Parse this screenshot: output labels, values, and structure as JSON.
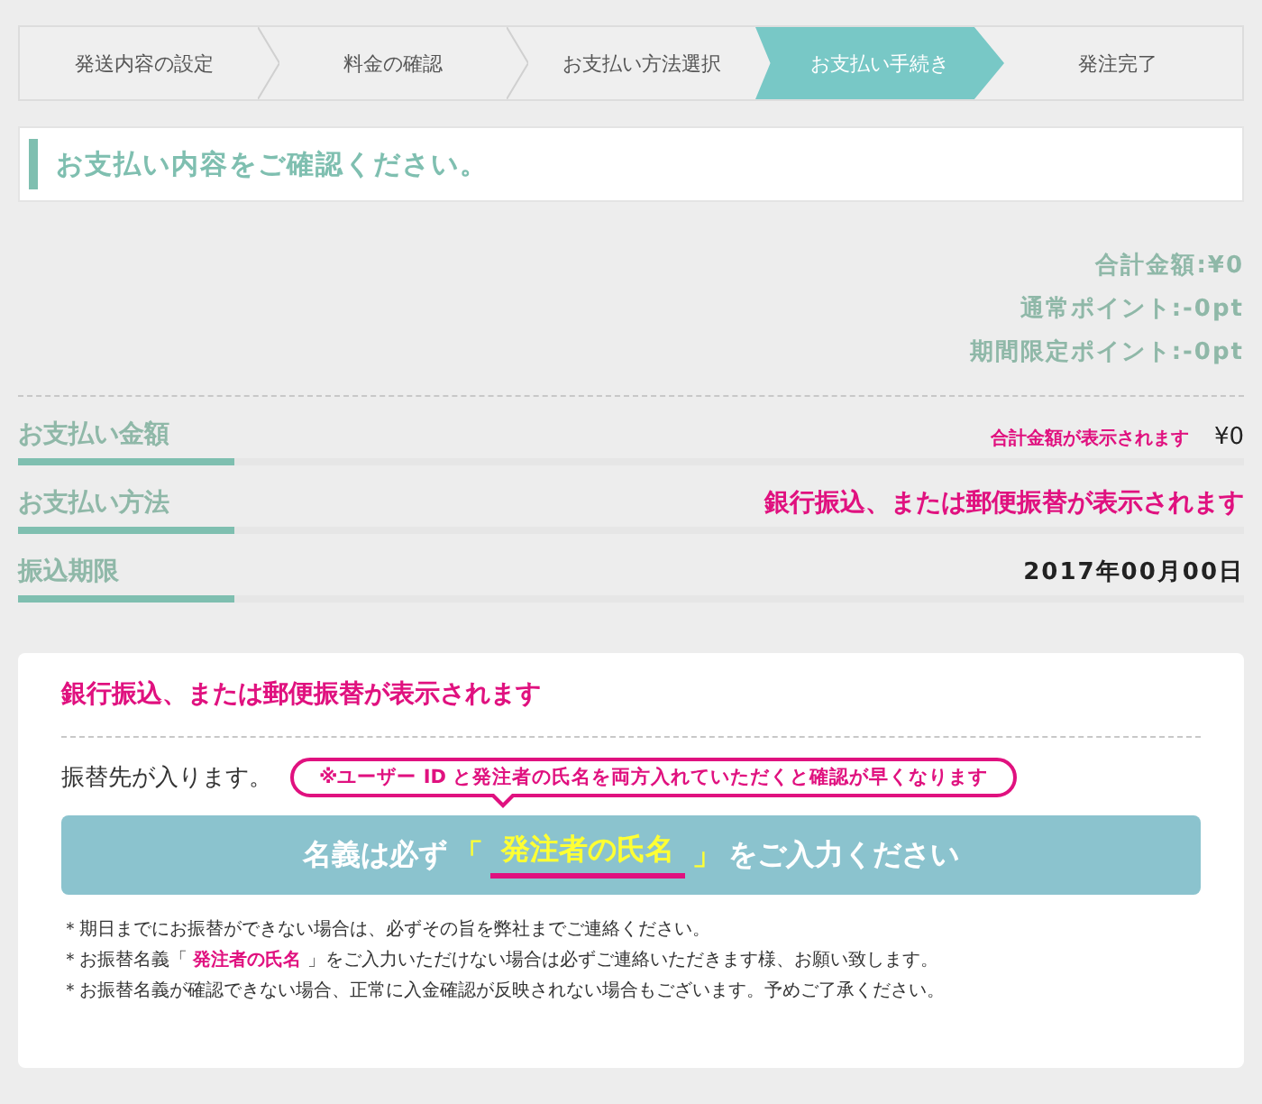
{
  "steps": [
    {
      "label": "発送内容の設定",
      "selected": false
    },
    {
      "label": "料金の確認",
      "selected": false
    },
    {
      "label": "お支払い方法選択",
      "selected": false
    },
    {
      "label": "お支払い手続き",
      "selected": true
    },
    {
      "label": "発注完了",
      "selected": false
    }
  ],
  "heading": "お支払い内容をご確認ください。",
  "totals": [
    "合計金額:¥0",
    "通常ポイント:-0pt",
    "期間限定ポイント:-0pt"
  ],
  "rows": [
    {
      "label": "お支払い金額",
      "kind": "amount",
      "note": "合計金額が表示されます",
      "value": "¥0"
    },
    {
      "label": "お支払い方法",
      "kind": "method",
      "value": "銀行振込、または郵便振替が表示されます"
    },
    {
      "label": "振込期限",
      "kind": "date",
      "value": "2017年00月00日"
    }
  ],
  "card": {
    "title": "銀行振込、または郵便振替が表示されます",
    "destination": "振替先が入ります。",
    "callout": "※ユーザー ID と発注者の氏名を両方入れていただくと確認が早くなります",
    "banner": {
      "before": "名義は必ず",
      "open": "「",
      "highlight": "発注者の氏名",
      "close": "」",
      "after": "をご入力ください"
    },
    "notes": [
      "＊期日までにお振替ができない場合は、必ずその旨を弊社までご連絡ください。",
      "＊お振替名義「 **発注者の氏名** 」をご入力いただけない場合は必ずご連絡いただきます様、お願い致します。",
      "＊お振替名義が確認できない場合、正常に入金確認が反映されない場合もございます。予めご了承ください。"
    ]
  }
}
